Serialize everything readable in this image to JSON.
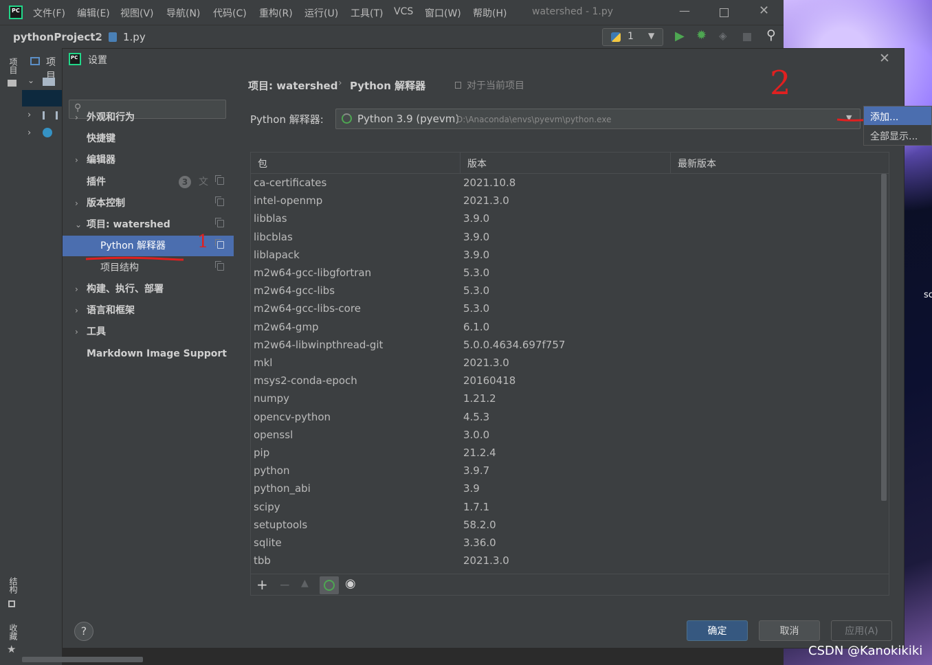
{
  "ide": {
    "app_icon": "pycharm-logo",
    "menu": [
      "文件(F)",
      "编辑(E)",
      "视图(V)",
      "导航(N)",
      "代码(C)",
      "重构(R)",
      "运行(U)",
      "工具(T)",
      "VCS",
      "窗口(W)",
      "帮助(H)"
    ],
    "window_title": "watershed - 1.py",
    "breadcrumb_project": "pythonProject2",
    "breadcrumb_file": "1.py",
    "run_config": "1",
    "left_strip_tabs": [
      "项目",
      "结构",
      "收藏"
    ],
    "project_panel_label": "项目"
  },
  "dialog": {
    "title": "设置",
    "search_placeholder": "",
    "nav": [
      {
        "label": "外观和行为",
        "chevron": "›"
      },
      {
        "label": "快捷键",
        "chevron": ""
      },
      {
        "label": "编辑器",
        "chevron": "›"
      },
      {
        "label": "插件",
        "chevron": "",
        "badge": "3"
      },
      {
        "label": "版本控制",
        "chevron": "›"
      },
      {
        "label": "项目: watershed",
        "chevron": "⌄"
      },
      {
        "label": "Python 解释器",
        "chevron": ""
      },
      {
        "label": "项目结构",
        "chevron": ""
      },
      {
        "label": "构建、执行、部署",
        "chevron": "›"
      },
      {
        "label": "语言和框架",
        "chevron": "›"
      },
      {
        "label": "工具",
        "chevron": "›"
      },
      {
        "label": "Markdown Image Support",
        "chevron": ""
      }
    ],
    "breadcrumb_parent": "项目: watershed",
    "breadcrumb_sep": "›",
    "breadcrumb_current": "Python 解释器",
    "scope_note": "对于当前项目",
    "interpreter_label": "Python 解释器:",
    "interpreter_name": "Python 3.9 (pyevm)",
    "interpreter_path": "D:\\Anaconda\\envs\\pyevm\\python.exe",
    "dropdown_menu": [
      "添加...",
      "全部显示..."
    ],
    "table": {
      "headers": [
        "包",
        "版本",
        "最新版本"
      ],
      "rows": [
        [
          "ca-certificates",
          "2021.10.8"
        ],
        [
          "intel-openmp",
          "2021.3.0"
        ],
        [
          "libblas",
          "3.9.0"
        ],
        [
          "libcblas",
          "3.9.0"
        ],
        [
          "liblapack",
          "3.9.0"
        ],
        [
          "m2w64-gcc-libgfortran",
          "5.3.0"
        ],
        [
          "m2w64-gcc-libs",
          "5.3.0"
        ],
        [
          "m2w64-gcc-libs-core",
          "5.3.0"
        ],
        [
          "m2w64-gmp",
          "6.1.0"
        ],
        [
          "m2w64-libwinpthread-git",
          "5.0.0.4634.697f757"
        ],
        [
          "mkl",
          "2021.3.0"
        ],
        [
          "msys2-conda-epoch",
          "20160418"
        ],
        [
          "numpy",
          "1.21.2"
        ],
        [
          "opencv-python",
          "4.5.3"
        ],
        [
          "openssl",
          "3.0.0"
        ],
        [
          "pip",
          "21.2.4"
        ],
        [
          "python",
          "3.9.7"
        ],
        [
          "python_abi",
          "3.9"
        ],
        [
          "scipy",
          "1.7.1"
        ],
        [
          "setuptools",
          "58.2.0"
        ],
        [
          "sqlite",
          "3.36.0"
        ],
        [
          "tbb",
          "2021.3.0"
        ]
      ]
    },
    "help": "?",
    "ok": "确定",
    "cancel": "取消",
    "apply": "应用(A)"
  },
  "annotations": {
    "mark1": "1",
    "mark2": "2"
  },
  "watermark": "CSDN @Kanokikiki",
  "wallpaper_text": "sc"
}
